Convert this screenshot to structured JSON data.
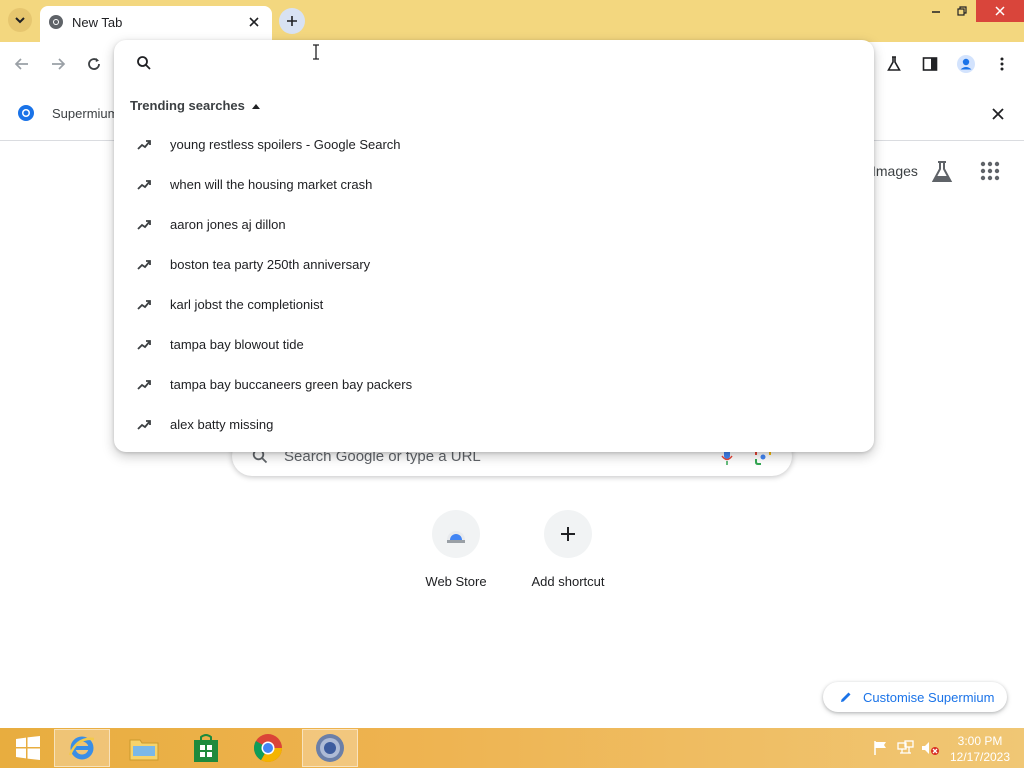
{
  "browser": {
    "tab_title": "New Tab",
    "info_bar_text": "Supermium"
  },
  "omnibox": {
    "section_title": "Trending searches",
    "suggestions": [
      "young restless spoilers - Google Search",
      "when will the housing market crash",
      "aaron jones aj dillon",
      "boston tea party 250th anniversary",
      "karl jobst the completionist",
      "tampa bay blowout tide",
      "tampa bay buccaneers green bay packers",
      "alex batty missing"
    ]
  },
  "ntp": {
    "images_link": "Images",
    "search_placeholder": "Search Google or type a URL",
    "shortcuts": [
      {
        "label": "Web Store",
        "icon": "web-store-icon"
      },
      {
        "label": "Add shortcut",
        "icon": "plus-icon"
      }
    ],
    "customise_label": "Customise Supermium"
  },
  "taskbar": {
    "time": "3:00 PM",
    "date": "12/17/2023"
  },
  "colors": {
    "titlebar": "#f3d77f",
    "accent": "#1a73e8",
    "taskbar": "#eeb350"
  }
}
